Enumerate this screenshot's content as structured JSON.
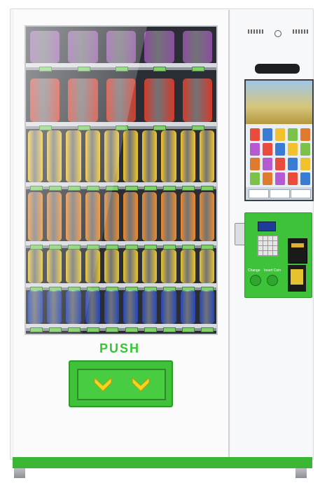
{
  "machine": {
    "push_label": "PUSH",
    "brand_green": "#3fc23a",
    "screen_buttons": [
      "",
      "",
      ""
    ],
    "payment": {
      "change_label": "Change",
      "insert_coin_label": "Insert Coin"
    }
  },
  "shelves": [
    {
      "row": 1,
      "product": "snack-bag",
      "color": "#8a4f9e",
      "count": 5
    },
    {
      "row": 2,
      "product": "food-pouch",
      "color": "#d33a2a",
      "count": 5
    },
    {
      "row": 3,
      "product": "yellow-bottle",
      "color": "#f3c62a",
      "count": 10
    },
    {
      "row": 4,
      "product": "orange-bottle",
      "color": "#ee8b2c",
      "count": 10
    },
    {
      "row": 5,
      "product": "can",
      "color": "#e8c52f",
      "count": 10
    },
    {
      "row": 6,
      "product": "can",
      "color": "#2747b5",
      "count": 10
    }
  ]
}
